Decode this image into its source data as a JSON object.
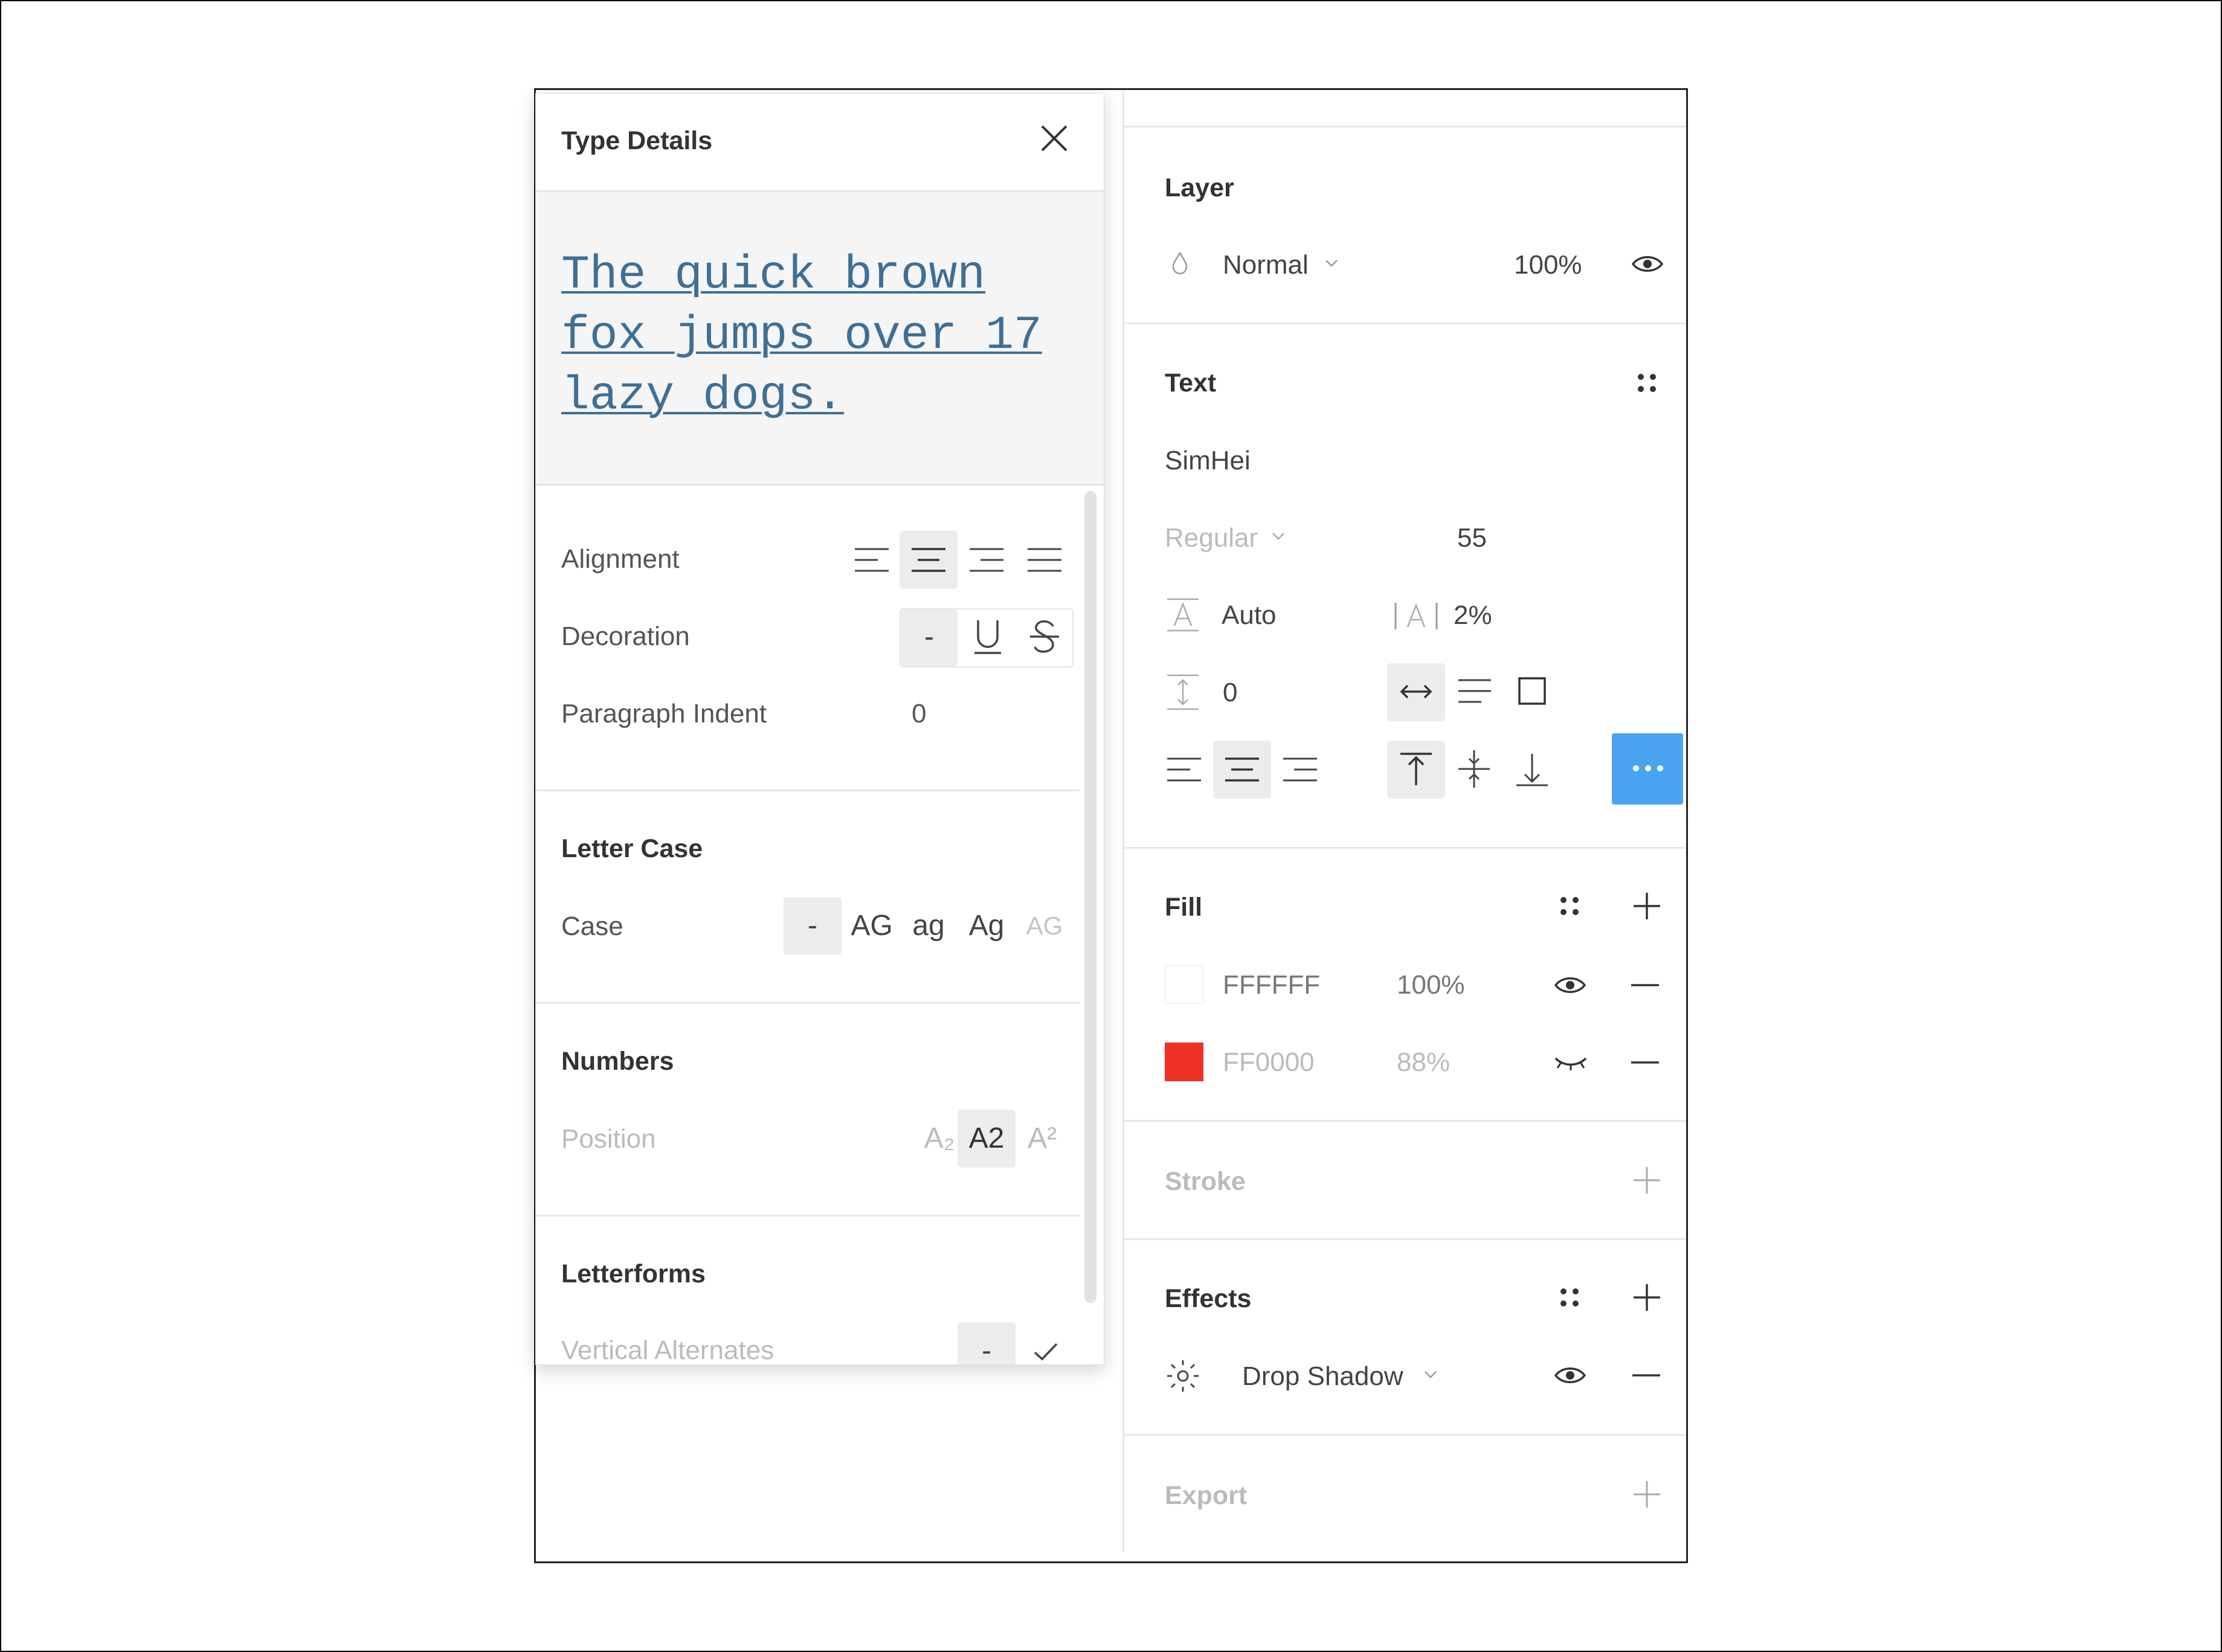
{
  "popup": {
    "title": "Type Details",
    "preview_lines": [
      "The quick brown",
      "fox jumps over 17",
      "lazy dogs."
    ],
    "alignment_label": "Alignment",
    "decoration_label": "Decoration",
    "decoration_none": "-",
    "paragraph_indent_label": "Paragraph Indent",
    "paragraph_indent_value": "0",
    "letter_case_header": "Letter Case",
    "case_label": "Case",
    "case_options": [
      "-",
      "AG",
      "ag",
      "Ag",
      "AG"
    ],
    "numbers_header": "Numbers",
    "position_label": "Position",
    "position_options": [
      "A₂",
      "A2",
      "A²"
    ],
    "letterforms_header": "Letterforms",
    "vertical_alternates_label": "Vertical Alternates",
    "vertical_alternates_none": "-"
  },
  "panel": {
    "layer": {
      "header": "Layer",
      "blend_mode": "Normal",
      "opacity": "100%"
    },
    "text": {
      "header": "Text",
      "font_family": "SimHei",
      "font_weight": "Regular",
      "font_size": "55",
      "line_height": "Auto",
      "letter_spacing": "2%",
      "paragraph_spacing": "0"
    },
    "fill": {
      "header": "Fill",
      "items": [
        {
          "hex": "FFFFFF",
          "opacity": "100%",
          "swatch": "#ffffff",
          "visible": true
        },
        {
          "hex": "FF0000",
          "opacity": "88%",
          "swatch": "#ee3125",
          "visible": false
        }
      ]
    },
    "stroke": {
      "header": "Stroke"
    },
    "effects": {
      "header": "Effects",
      "items": [
        {
          "name": "Drop Shadow"
        }
      ]
    },
    "export": {
      "header": "Export"
    }
  },
  "colors": {
    "accent": "#4aa3f2",
    "preview_text": "#3e6f96"
  }
}
